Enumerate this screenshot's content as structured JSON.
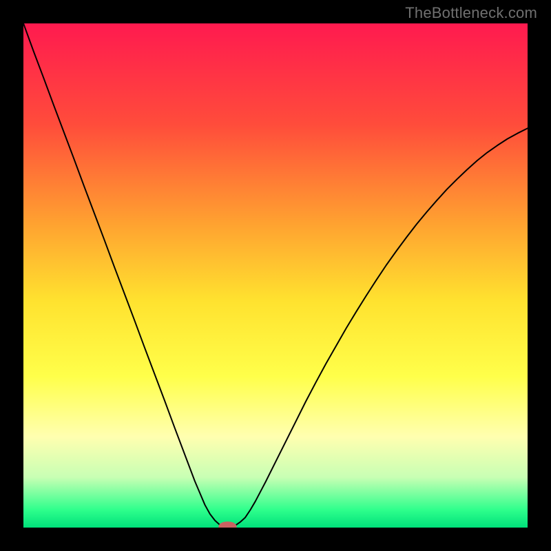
{
  "watermark": "TheBottleneck.com",
  "chart_data": {
    "type": "line",
    "title": "",
    "xlabel": "",
    "ylabel": "",
    "xlim": [
      0,
      1
    ],
    "ylim": [
      0,
      1
    ],
    "background_gradient": {
      "stops": [
        {
          "offset": 0.0,
          "color": "#ff1a4f"
        },
        {
          "offset": 0.2,
          "color": "#ff4c3b"
        },
        {
          "offset": 0.4,
          "color": "#ffa330"
        },
        {
          "offset": 0.55,
          "color": "#ffe22f"
        },
        {
          "offset": 0.7,
          "color": "#ffff4a"
        },
        {
          "offset": 0.82,
          "color": "#ffffb0"
        },
        {
          "offset": 0.9,
          "color": "#c8ffb4"
        },
        {
          "offset": 0.965,
          "color": "#2eff8c"
        },
        {
          "offset": 1.0,
          "color": "#00e07a"
        }
      ]
    },
    "series": [
      {
        "name": "bottleneck-v-curve",
        "color": "#000000",
        "width": 2,
        "x": [
          0.0,
          0.02,
          0.04,
          0.06,
          0.08,
          0.1,
          0.12,
          0.14,
          0.16,
          0.18,
          0.2,
          0.22,
          0.24,
          0.26,
          0.28,
          0.3,
          0.32,
          0.34,
          0.36,
          0.37,
          0.38,
          0.39,
          0.4,
          0.41,
          0.42,
          0.43,
          0.44,
          0.45,
          0.46,
          0.48,
          0.5,
          0.52,
          0.54,
          0.56,
          0.58,
          0.6,
          0.62,
          0.64,
          0.66,
          0.68,
          0.7,
          0.72,
          0.74,
          0.76,
          0.78,
          0.8,
          0.82,
          0.84,
          0.86,
          0.88,
          0.9,
          0.92,
          0.94,
          0.96,
          0.98,
          1.0
        ],
        "y": [
          1.0,
          0.945,
          0.892,
          0.838,
          0.785,
          0.732,
          0.678,
          0.625,
          0.572,
          0.518,
          0.465,
          0.412,
          0.358,
          0.305,
          0.252,
          0.198,
          0.145,
          0.092,
          0.045,
          0.027,
          0.014,
          0.005,
          0.001,
          0.001,
          0.004,
          0.011,
          0.02,
          0.035,
          0.052,
          0.09,
          0.13,
          0.17,
          0.21,
          0.25,
          0.288,
          0.325,
          0.36,
          0.395,
          0.428,
          0.46,
          0.491,
          0.521,
          0.549,
          0.576,
          0.602,
          0.626,
          0.649,
          0.671,
          0.691,
          0.71,
          0.728,
          0.744,
          0.758,
          0.771,
          0.782,
          0.792
        ]
      }
    ],
    "marker": {
      "name": "optimal-marker",
      "x": 0.405,
      "y": 0.002,
      "rx": 0.018,
      "ry": 0.01,
      "color": "#c96262"
    }
  }
}
